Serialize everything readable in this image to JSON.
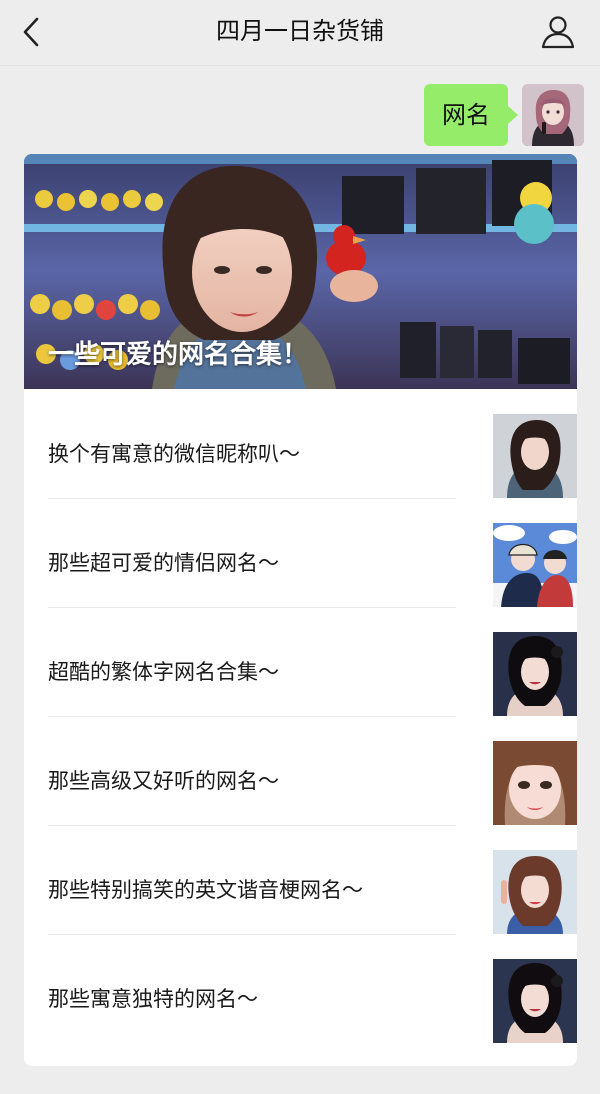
{
  "header": {
    "title": "四月一日杂货铺"
  },
  "chat": {
    "message": "网名"
  },
  "card": {
    "hero_title": "一些可爱的网名合集！",
    "items": [
      {
        "label": "换个有寓意的微信昵称叭～",
        "thumb": "portrait-1"
      },
      {
        "label": "那些超可爱的情侣网名～",
        "thumb": "couple-illustration"
      },
      {
        "label": "超酷的繁体字网名合集～",
        "thumb": "portrait-2"
      },
      {
        "label": "那些高级又好听的网名～",
        "thumb": "portrait-3"
      },
      {
        "label": "那些特别搞笑的英文谐音梗网名～",
        "thumb": "portrait-4"
      },
      {
        "label": "那些寓意独特的网名～",
        "thumb": "portrait-5"
      }
    ]
  },
  "colors": {
    "background": "#ededed",
    "bubble": "#95ec69",
    "card": "#ffffff",
    "text": "#1a1a1a"
  }
}
